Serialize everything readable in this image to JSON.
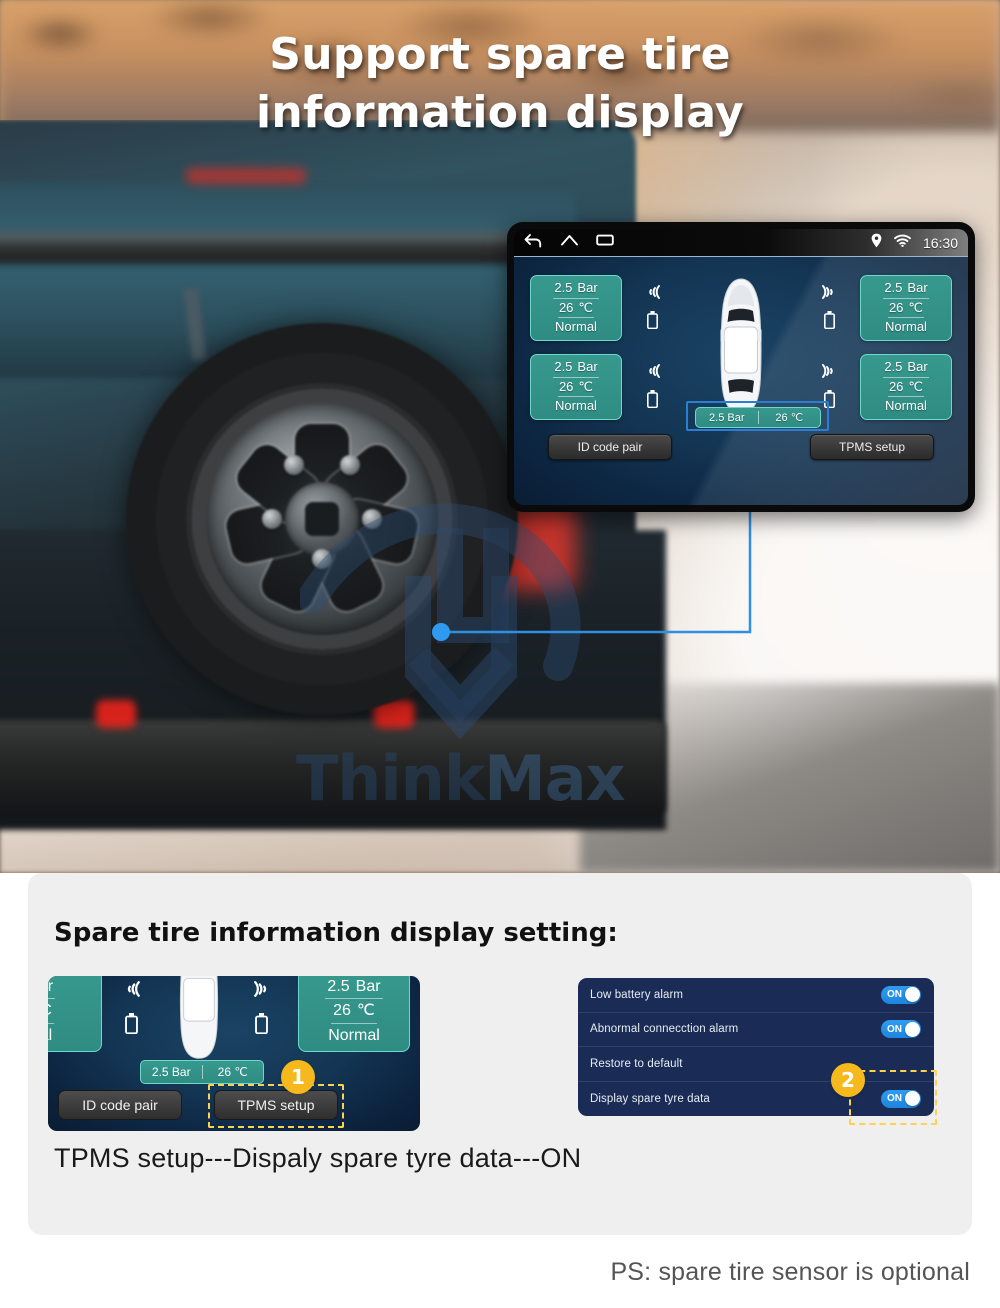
{
  "hero": {
    "title_line1": "Support spare tire",
    "title_line2": "information display",
    "watermark": {
      "part1": "Think",
      "part2": "Max"
    }
  },
  "head_unit": {
    "statusbar": {
      "back_icon": "back-arrow-icon",
      "home_icon": "home-icon",
      "recents_icon": "recents-icon",
      "location_icon": "location-pin-icon",
      "wifi_icon": "wifi-icon",
      "time": "16:30"
    },
    "tires": [
      {
        "position": "front-left",
        "pressure": "2.5",
        "pressure_unit": "Bar",
        "temperature": "26",
        "temperature_unit": "℃",
        "status": "Normal"
      },
      {
        "position": "front-right",
        "pressure": "2.5",
        "pressure_unit": "Bar",
        "temperature": "26",
        "temperature_unit": "℃",
        "status": "Normal"
      },
      {
        "position": "rear-left",
        "pressure": "2.5",
        "pressure_unit": "Bar",
        "temperature": "26",
        "temperature_unit": "℃",
        "status": "Normal"
      },
      {
        "position": "rear-right",
        "pressure": "2.5",
        "pressure_unit": "Bar",
        "temperature": "26",
        "temperature_unit": "℃",
        "status": "Normal"
      }
    ],
    "spare": {
      "pressure": "2.5 Bar",
      "temperature": "26 ℃"
    },
    "buttons": {
      "id_code_pair": "ID code pair",
      "tpms_setup": "TPMS setup"
    },
    "colors": {
      "card_fill": "#37998e",
      "card_border": "#6fd9c9",
      "screen_bg": "#143655",
      "highlight": "#2a7fd4"
    }
  },
  "panel": {
    "title": "Spare tire information display setting:",
    "note": "TPMS setup---Dispaly spare tyre data---ON",
    "mini_screen": {
      "tire_right": {
        "pressure": "2.5",
        "pressure_unit": "Bar",
        "temperature": "26",
        "temperature_unit": "℃",
        "status": "Normal"
      },
      "tire_left_clipped": {
        "pressure_unit": "ar",
        "temperature_unit": "C",
        "status": "al"
      },
      "spare": {
        "pressure": "2.5 Bar",
        "temperature": "26 ℃"
      },
      "buttons": {
        "id_code_pair": "ID code pair",
        "tpms_setup": "TPMS setup"
      }
    },
    "settings": {
      "rows": [
        {
          "label": "Low battery alarm",
          "toggle": "ON",
          "has_toggle": true
        },
        {
          "label": "Abnormal connecction alarm",
          "toggle": "ON",
          "has_toggle": true
        },
        {
          "label": "Restore to default",
          "toggle": "",
          "has_toggle": false
        },
        {
          "label": "Display spare tyre data",
          "toggle": "ON",
          "has_toggle": true
        }
      ]
    },
    "step_badges": {
      "one": "1",
      "two": "2"
    },
    "colors": {
      "panel_bg": "#efefef",
      "badge": "#f5b91e",
      "dashed": "#ffd24d",
      "settings_bg": "#1a2c55",
      "toggle_on": "#2f9bf0"
    }
  },
  "footer": {
    "ps": "PS: spare tire sensor is optional"
  }
}
